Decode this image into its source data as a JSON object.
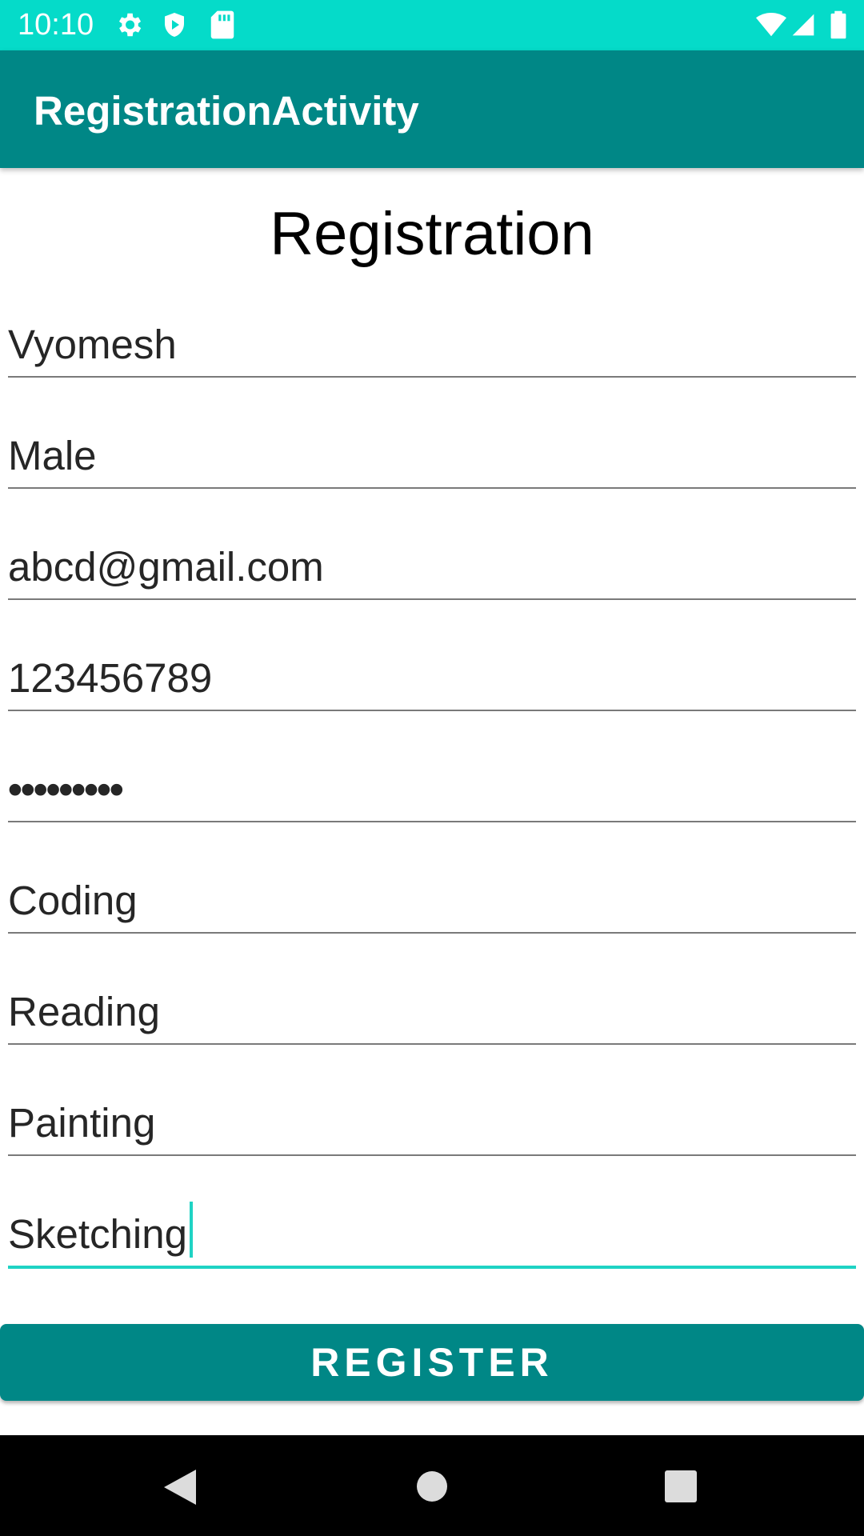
{
  "status_bar": {
    "time": "10:10",
    "left_icons": [
      "gear-icon",
      "shield-icon",
      "sd-card-icon"
    ],
    "right_icons": [
      "wifi-icon",
      "cell-signal-icon",
      "battery-icon"
    ],
    "background": "#05dbc9"
  },
  "app_bar": {
    "title": "RegistrationActivity",
    "background": "#008786"
  },
  "form": {
    "heading": "Registration",
    "fields": [
      {
        "value": "Vyomesh"
      },
      {
        "value": "Male"
      },
      {
        "value": "abcd@gmail.com"
      },
      {
        "value": "123456789"
      },
      {
        "value": "•••••••••",
        "type": "password"
      },
      {
        "value": "Coding"
      },
      {
        "value": "Reading"
      },
      {
        "value": "Painting"
      },
      {
        "value": "Sketching",
        "focused": true
      }
    ],
    "accent": "#1fd3c4"
  },
  "register_button": {
    "label": "REGISTER",
    "background": "#008786"
  },
  "nav_bar": {
    "buttons": [
      "back-icon",
      "home-icon",
      "recents-icon"
    ]
  }
}
